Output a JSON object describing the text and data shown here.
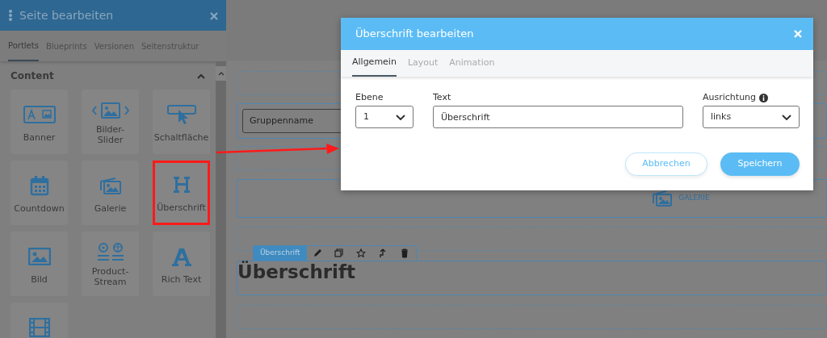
{
  "sidebar": {
    "title": "Seite bearbeiten",
    "tabs": [
      {
        "label": "Portlets",
        "selected": true
      },
      {
        "label": "Blueprints",
        "selected": false
      },
      {
        "label": "Versionen",
        "selected": false
      },
      {
        "label": "Seitenstruktur",
        "selected": false
      }
    ],
    "section": {
      "title": "Content",
      "expanded": true
    },
    "portlets": [
      {
        "kind": "banner",
        "label": "Banner",
        "highlighted": false
      },
      {
        "kind": "slider",
        "label": "Bilder-Slider",
        "highlighted": false
      },
      {
        "kind": "button",
        "label": "Schaltfläche",
        "highlighted": false
      },
      {
        "kind": "countdown",
        "label": "Countdown",
        "highlighted": false
      },
      {
        "kind": "gallery",
        "label": "Galerie",
        "highlighted": false
      },
      {
        "kind": "heading",
        "label": "Überschrift",
        "highlighted": true
      },
      {
        "kind": "image",
        "label": "Bild",
        "highlighted": false
      },
      {
        "kind": "stream",
        "label": "Product-Stream",
        "highlighted": false
      },
      {
        "kind": "richtext",
        "label": "Rich Text",
        "highlighted": false
      },
      {
        "kind": "video",
        "highlighted": false
      }
    ]
  },
  "canvas": {
    "group_field": {
      "value": "Gruppenname"
    },
    "gallery_label": "GALERIE",
    "heading_block": {
      "toolbar_label": "Überschrift",
      "text": "Überschrift"
    }
  },
  "dialog": {
    "title": "Überschrift bearbeiten",
    "tabs": [
      {
        "label": "Allgemein",
        "selected": true
      },
      {
        "label": "Layout",
        "selected": false
      },
      {
        "label": "Animation",
        "selected": false
      }
    ],
    "fields": [
      {
        "kind": "select",
        "label": "Ebene",
        "value": "1"
      },
      {
        "kind": "text",
        "label": "Text",
        "value": "Überschrift"
      },
      {
        "kind": "select",
        "label": "Ausrichtung",
        "value": "links",
        "info": true
      }
    ],
    "buttons": [
      {
        "kind": "secondary",
        "label": "Abbrechen"
      },
      {
        "kind": "primary",
        "label": "Speichern"
      }
    ]
  }
}
